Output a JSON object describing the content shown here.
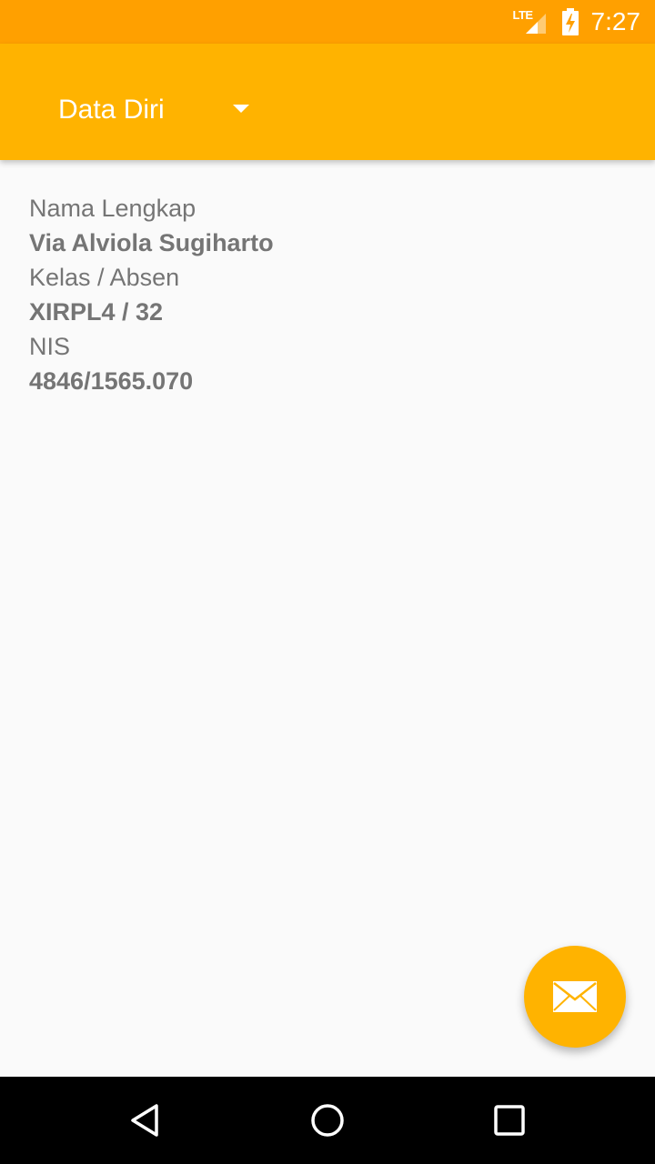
{
  "status_bar": {
    "network": "LTE",
    "time": "7:27"
  },
  "app_bar": {
    "spinner_label": "Data Diri"
  },
  "profile": {
    "fields": [
      {
        "label": "Nama Lengkap",
        "value": "Via Alviola Sugiharto"
      },
      {
        "label": "Kelas / Absen",
        "value": "XIRPL4 / 32"
      },
      {
        "label": "NIS",
        "value": "4846/1565.070"
      }
    ]
  },
  "colors": {
    "status_bar": "#ffa000",
    "app_bar": "#ffb300",
    "fab": "#ffb300",
    "text": "#757575"
  },
  "icons": {
    "fab": "email-icon",
    "nav": [
      "back-icon",
      "home-icon",
      "recent-apps-icon"
    ]
  }
}
